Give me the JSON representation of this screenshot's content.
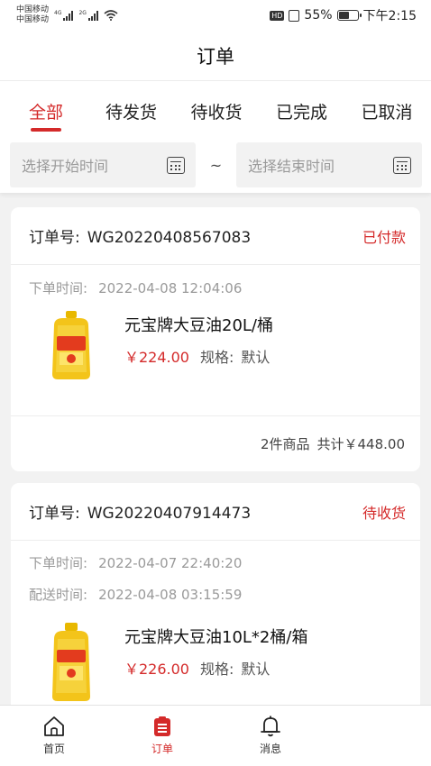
{
  "status_bar": {
    "carrier_1": "中国移动",
    "carrier_2": "中国移动",
    "net_1": "4G",
    "net_2": "2G",
    "hd": "HD",
    "battery": "55%",
    "battery_level": 0.55,
    "time": "下午2:15"
  },
  "header": {
    "title": "订单"
  },
  "tabs": [
    {
      "label": "全部",
      "active": true
    },
    {
      "label": "待发货",
      "active": false
    },
    {
      "label": "待收货",
      "active": false
    },
    {
      "label": "已完成",
      "active": false
    },
    {
      "label": "已取消",
      "active": false
    }
  ],
  "filter": {
    "start_placeholder": "选择开始时间",
    "separator": "~",
    "end_placeholder": "选择结束时间"
  },
  "orders": [
    {
      "order_no_label": "订单号:",
      "order_no": "WG20220408567083",
      "status": "已付款",
      "order_time_label": "下单时间:",
      "order_time": "2022-04-08 12:04:06",
      "product_name": "元宝牌大豆油20L/桶",
      "price": "￥224.00",
      "spec_label": "规格:",
      "spec_value": "默认",
      "summary_count": "2件商品",
      "summary_total": "共计￥448.00"
    },
    {
      "order_no_label": "订单号:",
      "order_no": "WG20220407914473",
      "status": "待收货",
      "order_time_label": "下单时间:",
      "order_time": "2022-04-07 22:40:20",
      "delivery_time_label": "配送时间:",
      "delivery_time": "2022-04-08 03:15:59",
      "product_name": "元宝牌大豆油10L*2桶/箱",
      "price": "￥226.00",
      "spec_label": "规格:",
      "spec_value": "默认"
    }
  ],
  "bottom_nav": [
    {
      "label": "首页",
      "icon": "home-icon",
      "active": false
    },
    {
      "label": "订单",
      "icon": "order-list-icon",
      "active": true
    },
    {
      "label": "消息",
      "icon": "bell-icon",
      "active": false
    }
  ],
  "colors": {
    "accent": "#d42a2a",
    "background": "#f2f2f2"
  }
}
